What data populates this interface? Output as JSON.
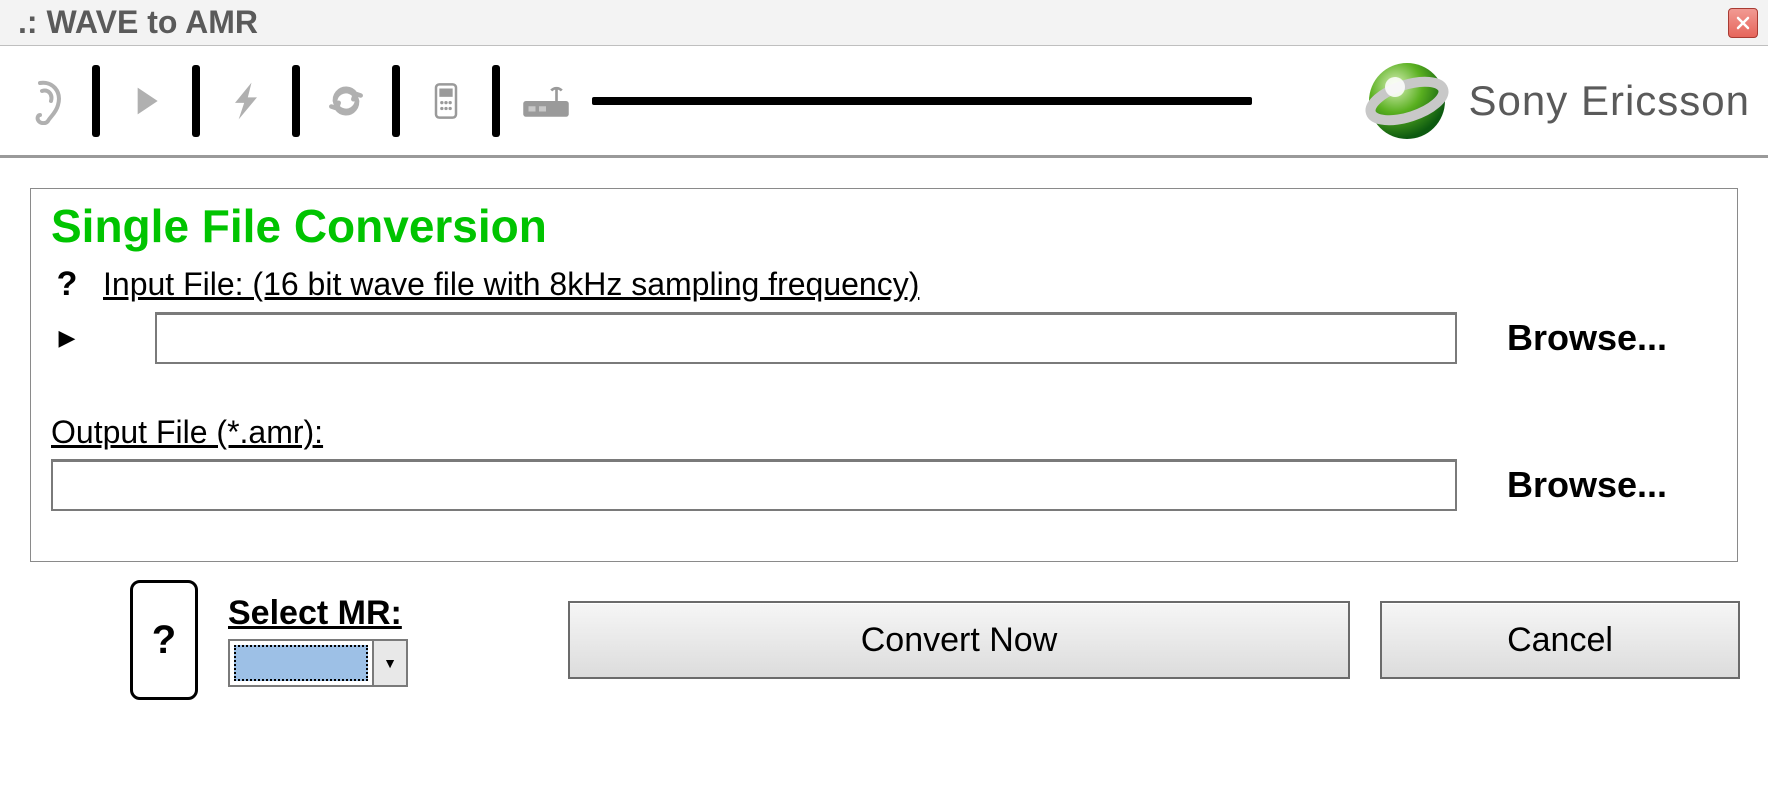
{
  "window": {
    "title": ".: WAVE to AMR"
  },
  "brand": {
    "name": "Sony Ericsson"
  },
  "panel": {
    "title": "Single File Conversion",
    "input_label": "Input File: (16 bit wave file with 8kHz sampling frequency)",
    "input_value": "",
    "input_browse": "Browse...",
    "output_label": "Output File (*.amr):",
    "output_value": "",
    "output_browse": "Browse..."
  },
  "bottom": {
    "help": "?",
    "mr_label": "Select MR:",
    "mr_value": "",
    "convert": "Convert Now",
    "cancel": "Cancel"
  },
  "icons": {
    "help_inline": "?"
  }
}
